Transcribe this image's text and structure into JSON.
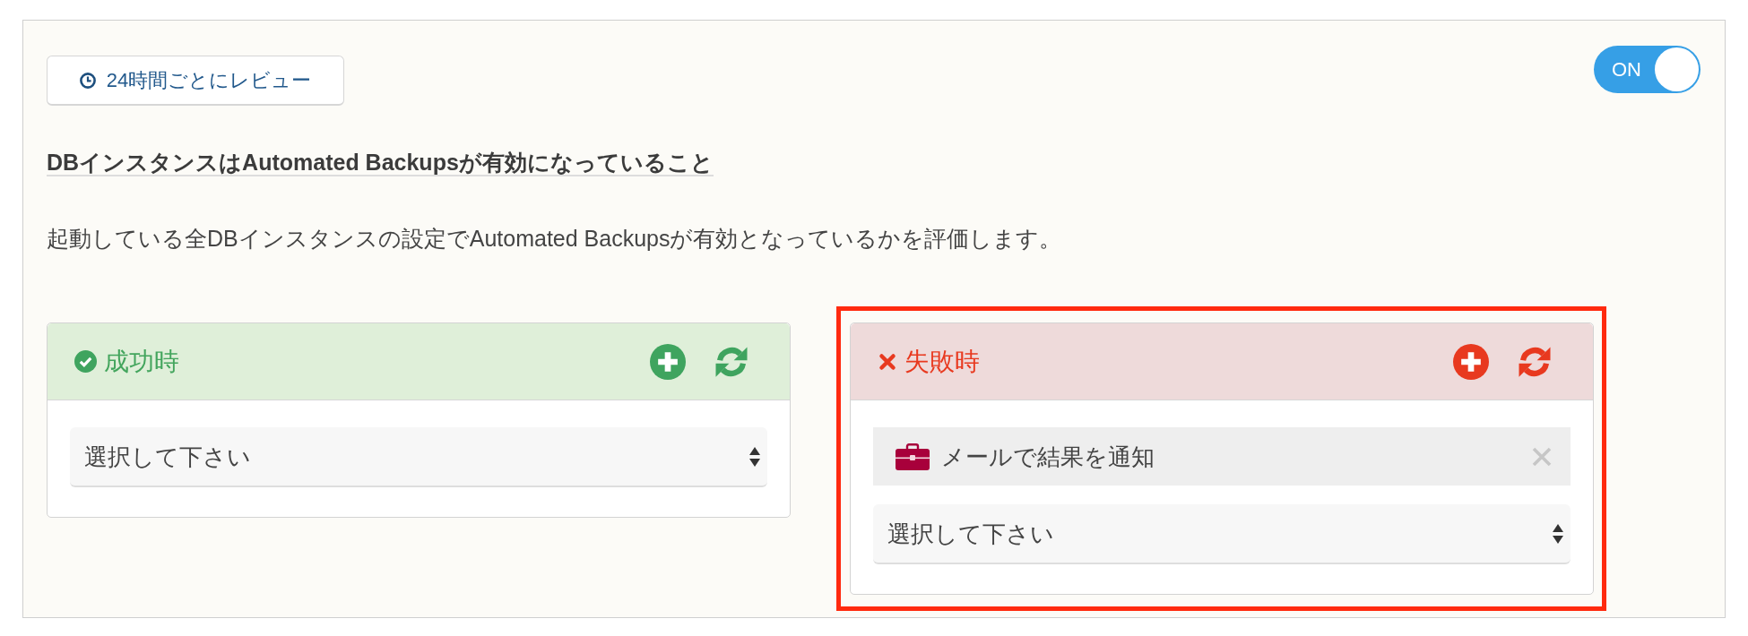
{
  "review_button": {
    "label": "24時間ごとにレビュー"
  },
  "toggle": {
    "label": "ON",
    "on": true
  },
  "title": "DBインスタンスはAutomated Backupsが有効になっていること",
  "description": "起動している全DBインスタンスの設定でAutomated Backupsが有効となっているかを評価します。",
  "panels": [
    {
      "kind": "success",
      "title": "成功時",
      "highlighted": false,
      "select": {
        "placeholder": "選択して下さい"
      }
    },
    {
      "kind": "failure",
      "title": "失敗時",
      "highlighted": true,
      "actions": [
        {
          "label": "メールで結果を通知"
        }
      ],
      "select": {
        "placeholder": "選択して下さい"
      }
    }
  ]
}
